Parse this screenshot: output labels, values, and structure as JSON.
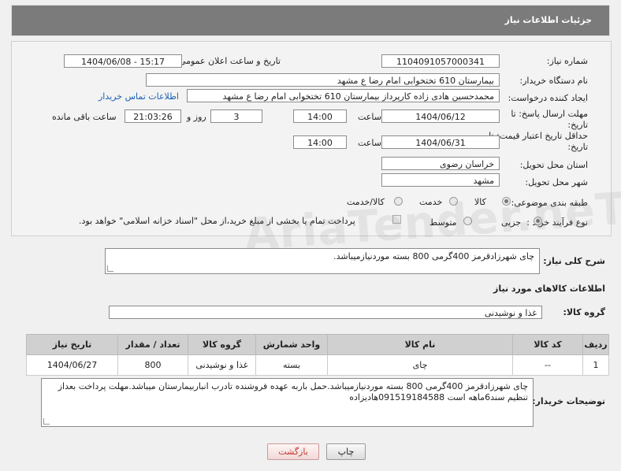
{
  "header": {
    "title": "جزئیات اطلاعات نیاز"
  },
  "form": {
    "need_number_label": "شماره نیاز:",
    "need_number": "1104091057000341",
    "announce_label": "تاریخ و ساعت اعلان عمومی:",
    "announce_value": "1404/06/08 - 15:17",
    "buyer_org_label": "نام دستگاه خریدار:",
    "buyer_org": "بیمارستان 610 تختخوابی امام رضا ع  مشهد",
    "requester_label": "ایجاد کننده درخواست:",
    "requester": "محمدحسین هادی زاده کارپرداز بیمارستان 610 تختخوابی امام رضا ع  مشهد",
    "contact_link": "اطلاعات تماس خریدار",
    "deadline_label": "مهلت ارسال پاسخ: تا تاریخ:",
    "deadline_date": "1404/06/12",
    "time_label": "ساعت",
    "deadline_time": "14:00",
    "days_value": "3",
    "days_label": "روز و",
    "remaining_time": "21:03:26",
    "remaining_label": "ساعت باقی مانده",
    "price_validity_label": "حداقل تاریخ اعتبار قیمت: تا تاریخ:",
    "price_validity_date": "1404/06/31",
    "price_validity_time": "14:00",
    "province_label": "استان محل تحویل:",
    "province": "خراسان رضوی",
    "city_label": "شهر محل تحویل:",
    "city": "مشهد",
    "category_label": "طبقه بندی موضوعی:",
    "category_options": [
      "کالا",
      "خدمت",
      "کالا/خدمت"
    ],
    "process_label": "نوع فرآیند خرید :",
    "process_options": [
      "جزیی",
      "متوسط"
    ],
    "payment_note": "پرداخت تمام یا بخشی از مبلغ خرید،از محل \"اسناد خزانه اسلامی\" خواهد بود."
  },
  "description": {
    "label": "شرح کلی نیاز:",
    "text": "چای شهرزادقرمز 400گرمی 800 بسته موردنیازمیباشد."
  },
  "goods_section": {
    "title": "اطلاعات کالاهای مورد نیاز",
    "group_label": "گروه کالا:",
    "group_value": "غذا و نوشیدنی"
  },
  "table": {
    "headers": [
      "ردیف",
      "کد کالا",
      "نام کالا",
      "واحد شمارش",
      "گروه کالا",
      "تعداد / مقدار",
      "تاریخ نیاز"
    ],
    "rows": [
      [
        "1",
        "--",
        "چای",
        "بسته",
        "غذا و نوشیدنی",
        "800",
        "1404/06/27"
      ]
    ]
  },
  "buyer_notes": {
    "label": "توضیحات خریدار:",
    "text": "چای شهرزادقرمز 400گرمی 800 بسته موردنیازمیباشد.حمل باربه عهده فروشنده تادرب انباربیمارستان میباشد.مهلت پرداخت بعداز تنظیم سند6ماهه است 09151918458‌8هادیزاده"
  },
  "buttons": {
    "print": "چاپ",
    "back": "بازگشت"
  },
  "watermark": "AriaTender.neT"
}
